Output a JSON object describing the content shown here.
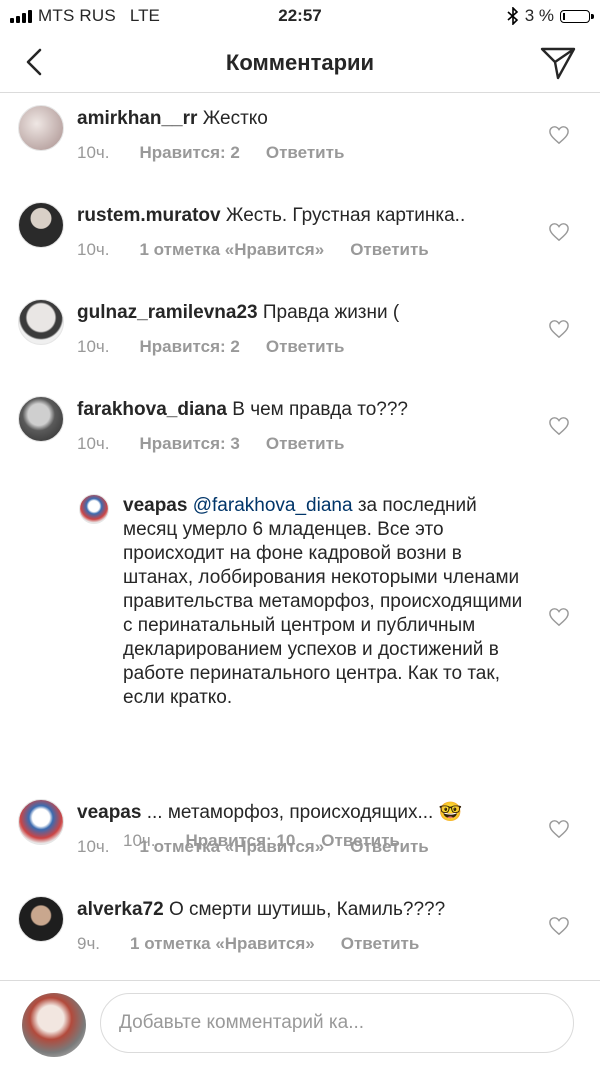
{
  "status_bar": {
    "carrier": "MTS RUS",
    "network": "LTE",
    "time": "22:57",
    "battery": "3 %",
    "bluetooth_icon": "bluetooth-icon"
  },
  "header": {
    "title": "Комментарии",
    "back_icon": "chevron-left-icon",
    "share_icon": "paper-plane-icon"
  },
  "comments": [
    {
      "username": "amirkhan__rr",
      "text": "Жестко",
      "time": "10ч.",
      "likes": "Нравится: 2",
      "reply": "Ответить"
    },
    {
      "username": "rustem.muratov",
      "text": "Жесть. Грустная картинка..",
      "time": "10ч.",
      "likes": "1 отметка «Нравится»",
      "reply": "Ответить"
    },
    {
      "username": "gulnaz_ramilevna23",
      "text": "Правда жизни (",
      "time": "10ч.",
      "likes": "Нравится: 2",
      "reply": "Ответить"
    },
    {
      "username": "farakhova_diana",
      "text": "В чем правда то???",
      "time": "10ч.",
      "likes": "Нравится: 3",
      "reply": "Ответить"
    },
    {
      "username": "veapas",
      "mention": "@farakhova_diana",
      "text": "за последний месяц умерло 6 младенцев. Все это происходит на фоне кадровой возни в штанах, лоббирования некоторыми членами правительства метаморфоз, происходящими с перинатальный центром и публичным декларированием успехов и достижений в работе перинатального центра. Как то так, если кратко.",
      "time": "10ч.",
      "likes": "Нравится: 10",
      "reply": "Ответить"
    },
    {
      "username": "veapas",
      "text": "... метаморфоз, происходящих... 🤓",
      "time": "10ч.",
      "likes": "1 отметка «Нравится»",
      "reply": "Ответить"
    },
    {
      "username": "alverka72",
      "text": "О смерти шутишь, Камиль????",
      "time": "9ч.",
      "likes": "1 отметка «Нравится»",
      "reply": "Ответить"
    }
  ],
  "composer": {
    "placeholder": "Добавьте комментарий ка..."
  },
  "colors": {
    "text": "#262626",
    "meta": "#999999",
    "mention": "#003569",
    "divider": "#dbdbdb"
  }
}
